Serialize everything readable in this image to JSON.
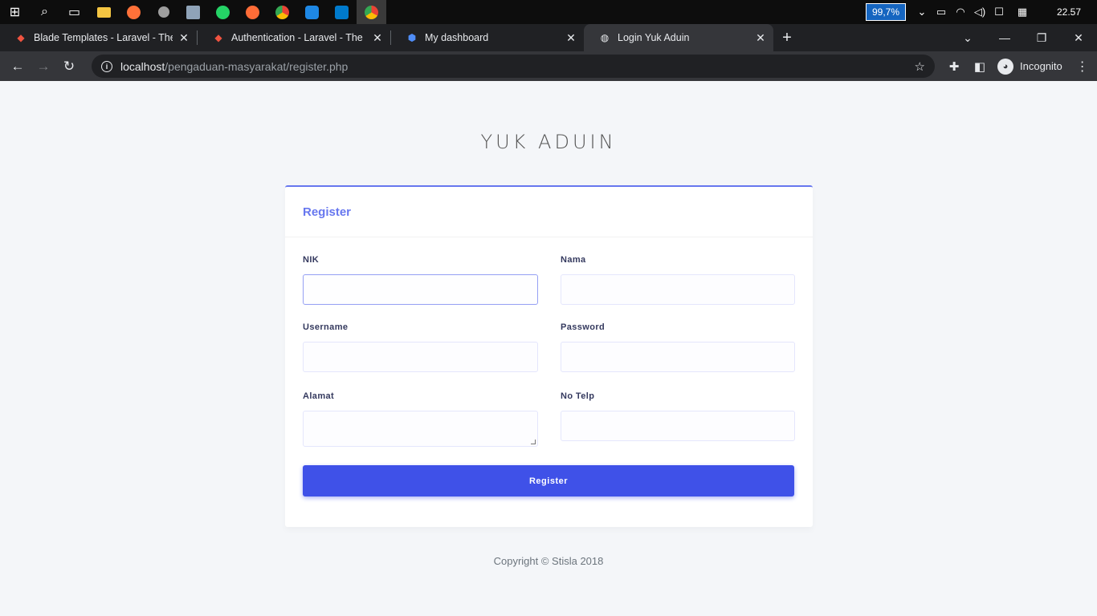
{
  "taskbar": {
    "apps": [
      {
        "name": "windows-start",
        "glyph": "⊞"
      },
      {
        "name": "search",
        "glyph": "⌕"
      },
      {
        "name": "task-view",
        "glyph": "▭"
      },
      {
        "name": "file-explorer",
        "glyph": "▬"
      },
      {
        "name": "firefox",
        "glyph": "●"
      },
      {
        "name": "app",
        "glyph": "◉"
      },
      {
        "name": "remote-desktop",
        "glyph": "▣"
      },
      {
        "name": "whatsapp",
        "glyph": "●"
      },
      {
        "name": "postman",
        "glyph": "●"
      },
      {
        "name": "chrome",
        "glyph": "◎"
      },
      {
        "name": "app-blue",
        "glyph": "◆"
      },
      {
        "name": "vscode",
        "glyph": "❰"
      },
      {
        "name": "chrome-active",
        "glyph": "◎"
      }
    ],
    "battery": "99,7%",
    "clock": "22.57"
  },
  "tabs": [
    {
      "title": "Blade Templates - Laravel - The P",
      "favicon": "laravel-icon"
    },
    {
      "title": "Authentication - Laravel - The PH",
      "favicon": "laravel-icon"
    },
    {
      "title": "My dashboard",
      "favicon": "shield-icon"
    },
    {
      "title": "Login Yuk Aduin",
      "favicon": "globe-icon"
    }
  ],
  "address": {
    "host": "localhost",
    "path": "/pengaduan-masyarakat/register.php"
  },
  "profile": {
    "label": "Incognito"
  },
  "page": {
    "brand": "YUK ADUIN",
    "card_title": "Register",
    "fields": {
      "nik": "NIK",
      "nama": "Nama",
      "username": "Username",
      "password": "Password",
      "alamat": "Alamat",
      "no_telp": "No Telp"
    },
    "submit_label": "Register",
    "footer": "Copyright © Stisla 2018"
  },
  "colors": {
    "primary": "#6777ef",
    "button": "#3f51e8",
    "background": "#f4f6f9"
  }
}
